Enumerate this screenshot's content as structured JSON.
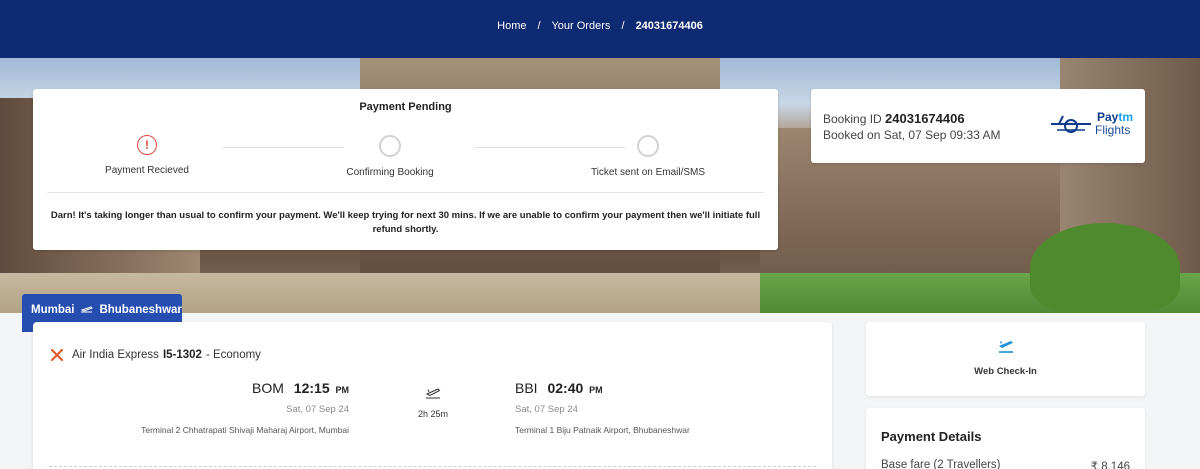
{
  "breadcrumb": {
    "home": "Home",
    "orders": "Your Orders",
    "current": "24031674406",
    "separator": "/"
  },
  "status": {
    "title": "Payment Pending",
    "steps": [
      {
        "label": "Payment Recieved",
        "state": "alert",
        "icon": "alert-icon",
        "glyph": "!"
      },
      {
        "label": "Confirming Booking",
        "state": "pending",
        "icon": "circle-icon"
      },
      {
        "label": "Ticket sent on Email/SMS",
        "state": "pending",
        "icon": "circle-icon"
      }
    ],
    "message": "Darn! It's taking longer than usual to confirm your payment. We'll keep trying for next 30 mins. If we are unable to confirm your payment then we'll initiate full refund shortly."
  },
  "booking": {
    "id_label": "Booking ID",
    "id": "24031674406",
    "booked_on": "Booked on Sat, 07 Sep 09:33 AM",
    "logo": {
      "paytm_prefix": "Pay",
      "paytm_suffix": "tm",
      "flights": "Flights"
    }
  },
  "route": {
    "from": "Mumbai",
    "to": "Bhubaneshwar",
    "icon": "plane-icon"
  },
  "flight": {
    "airline": "Air India Express",
    "flight_no": "I5-1302",
    "cabin": "- Economy",
    "departure": {
      "code": "BOM",
      "time": "12:15",
      "ampm": "PM",
      "date": "Sat, 07 Sep 24",
      "terminal": "Terminal 2 Chhatrapati Shivaji Maharaj Airport, Mumbai"
    },
    "arrival": {
      "code": "BBI",
      "time": "02:40",
      "ampm": "PM",
      "date": "Sat, 07 Sep 24",
      "terminal": "Terminal 1 Biju Patnaik Airport, Bhubaneshwar"
    },
    "duration": "2h 25m"
  },
  "webcheckin": {
    "label": "Web Check-In",
    "icon": "web-checkin-plane-icon"
  },
  "payment": {
    "title": "Payment Details",
    "rows": [
      {
        "label": "Base fare (2 Travellers)",
        "value": "₹ 8,146"
      }
    ]
  },
  "colors": {
    "header": "#0e2a72",
    "route_tag": "#264db0",
    "alert": "#e0493c",
    "airline": "#e2592e"
  }
}
